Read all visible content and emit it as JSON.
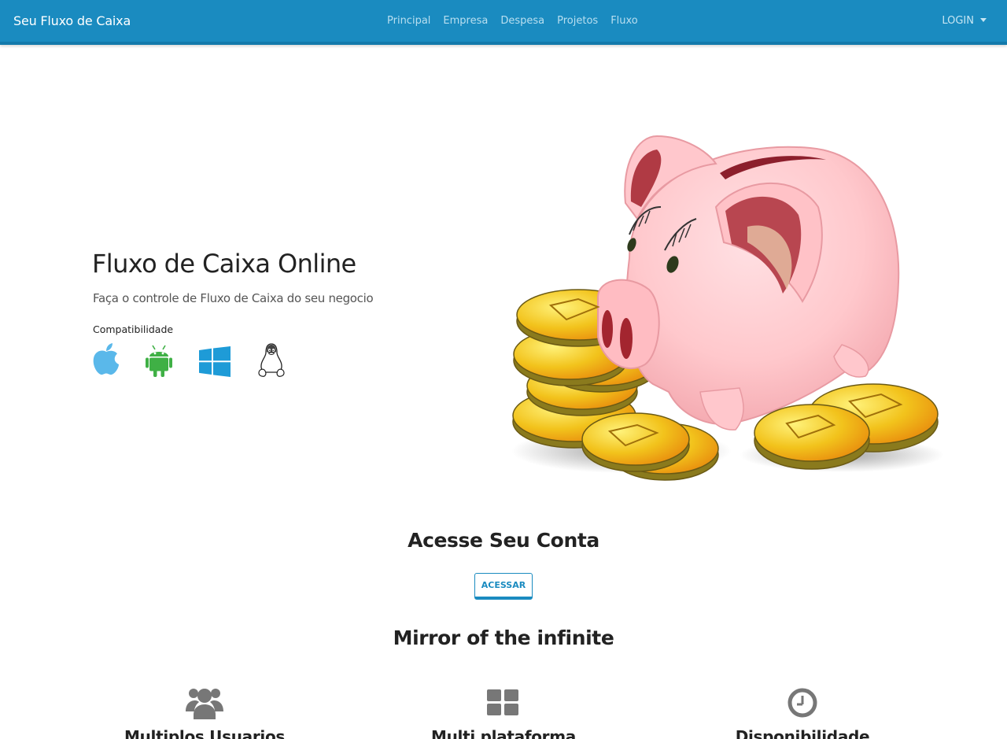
{
  "navbar": {
    "brand": "Seu Fluxo de Caixa",
    "links": [
      "Principal",
      "Empresa",
      "Despesa",
      "Projetos",
      "Fluxo"
    ],
    "login": "LOGIN"
  },
  "hero": {
    "title": "Fluxo de Caixa Online",
    "subtitle": "Faça o controle de Fluxo de Caixa do seu negocio",
    "compat_label": "Compatibilidade",
    "platforms": [
      "apple-icon",
      "android-icon",
      "windows-icon",
      "linux-icon"
    ],
    "illustration": "piggy-bank-with-coins"
  },
  "access": {
    "title": "Acesse Seu Conta",
    "button": "ACESSAR"
  },
  "features": {
    "title": "Mirror of the infinite",
    "items": [
      {
        "icon": "users-icon",
        "label": "Multiplos Usuarios"
      },
      {
        "icon": "grid-icon",
        "label": "Multi plataforma"
      },
      {
        "icon": "clock-icon",
        "label": "Disponibilidade"
      }
    ]
  },
  "colors": {
    "navbar": "#1a8bc0",
    "accent": "#1a8bc0",
    "apple": "#5ab8ea",
    "android": "#3fb045",
    "windows": "#1e9bd7",
    "feature_icon": "#777777"
  }
}
